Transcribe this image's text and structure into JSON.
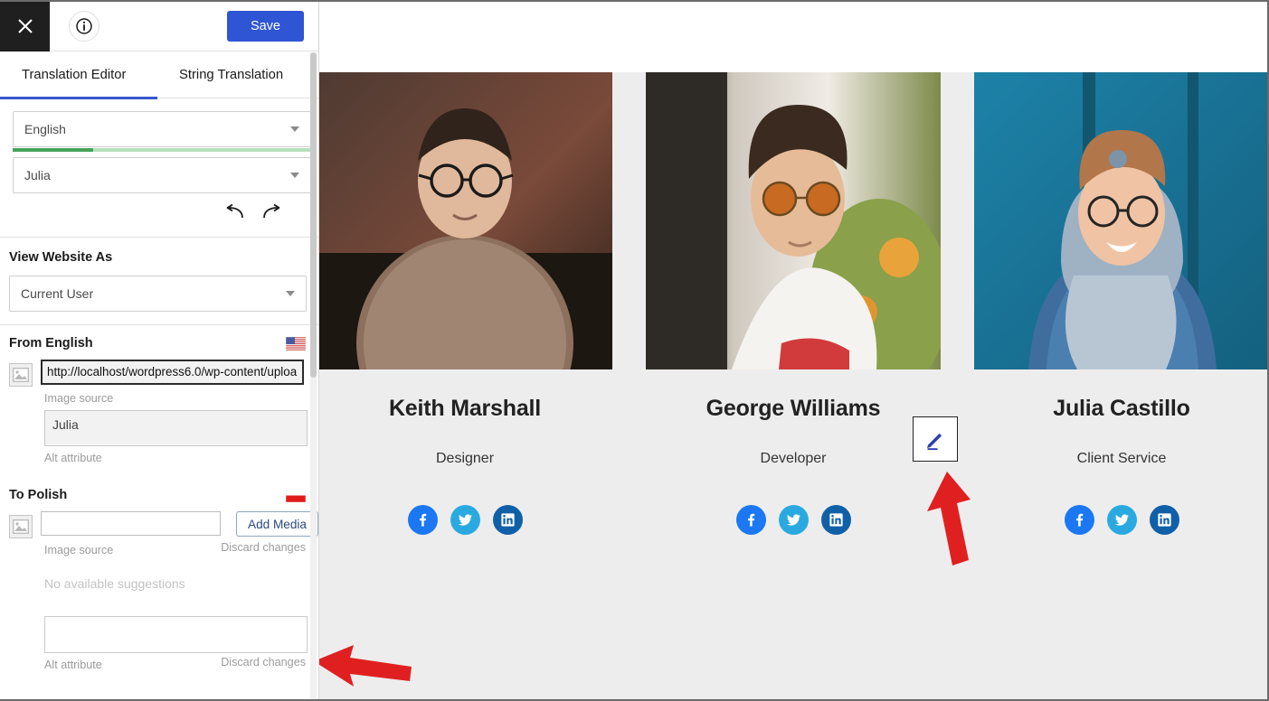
{
  "sidebar": {
    "topbar": {
      "close_icon": "close-icon",
      "info_icon": "info-icon",
      "save_label": "Save"
    },
    "tabs": [
      {
        "label": "Translation Editor",
        "active": true
      },
      {
        "label": "String Translation",
        "active": false
      }
    ],
    "language_select": {
      "value": "English",
      "caret_icon": "chevron-down-icon"
    },
    "progress_percent": 27,
    "progress_color": "#45a35a",
    "item_select": {
      "value": "Julia",
      "caret_icon": "chevron-down-icon"
    },
    "history": {
      "undo_icon": "undo-arrow-icon",
      "redo_icon": "redo-arrow-icon"
    },
    "view_website_as": {
      "heading": "View Website As",
      "select_value": "Current User",
      "caret_icon": "chevron-down-icon"
    },
    "source": {
      "heading": "From English",
      "flag": "us-flag-icon",
      "image_icon": "image-placeholder-icon",
      "image_source_value": "http://localhost/wordpress6.0/wp-content/uploa",
      "image_source_label": "Image source",
      "alt_value": "Julia",
      "alt_label": "Alt attribute"
    },
    "target": {
      "heading": "To Polish",
      "flag": "poland-flag-icon",
      "image_icon": "image-placeholder-icon",
      "image_source_value": "",
      "image_source_placeholder": "",
      "image_source_label": "Image source",
      "add_media_label": "Add Media",
      "discard_changes_label": "Discard changes",
      "no_suggestions_label": "No available suggestions",
      "alt_value": "",
      "alt_label": "Alt attribute",
      "alt_discard_label": "Discard changes"
    }
  },
  "main": {
    "cards": [
      {
        "name": "Keith Marshall",
        "role": "Designer",
        "socials": [
          "facebook-icon",
          "twitter-icon",
          "linkedin-icon"
        ]
      },
      {
        "name": "George Williams",
        "role": "Developer",
        "socials": [
          "facebook-icon",
          "twitter-icon",
          "linkedin-icon"
        ]
      },
      {
        "name": "Julia Castillo",
        "role": "Client Service",
        "socials": [
          "facebook-icon",
          "twitter-icon",
          "linkedin-icon"
        ]
      }
    ],
    "edit_badge_icon": "pencil-edit-icon",
    "annotation_arrows": [
      "red-arrow-up",
      "red-arrow-left"
    ]
  },
  "colors": {
    "accent_blue": "#2f55d4",
    "tab_underline": "#3858cf",
    "progress_green": "#45a35a",
    "annotation_red": "#e02020",
    "page_background": "#ededed",
    "facebook": "#1b78f2",
    "twitter": "#2aa9e0",
    "linkedin": "#1060a8"
  }
}
